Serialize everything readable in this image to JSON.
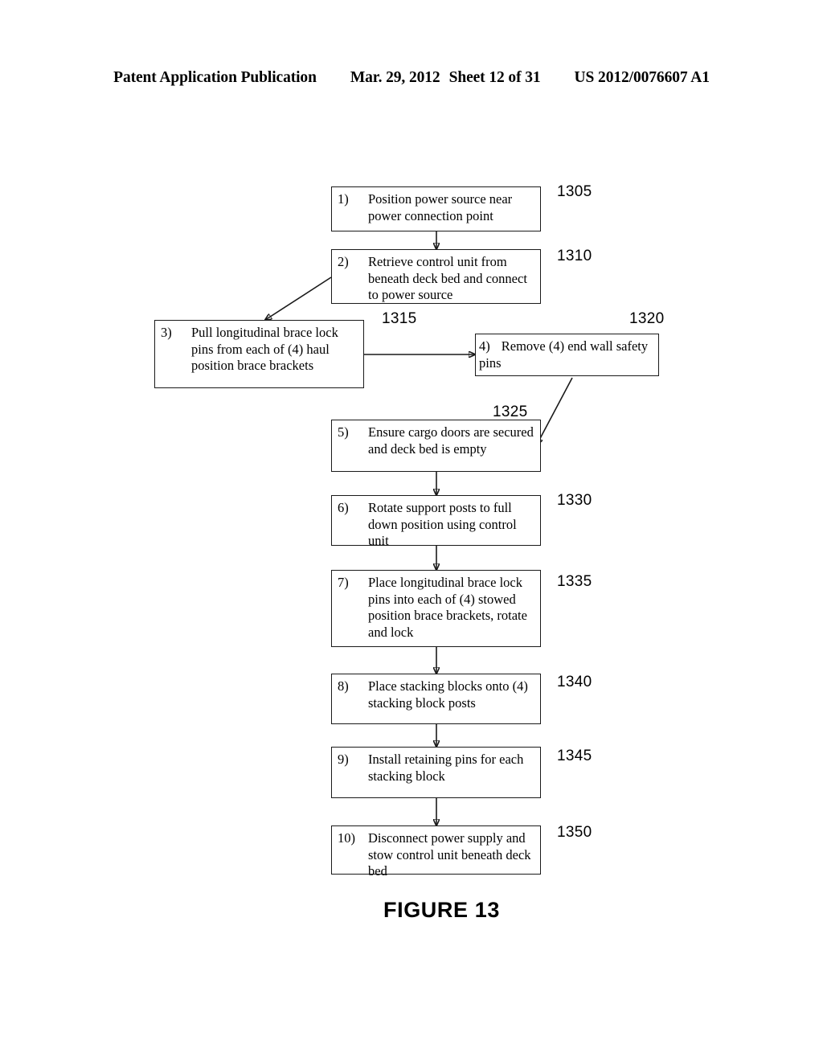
{
  "header": {
    "publication": "Patent Application Publication",
    "date": "Mar. 29, 2012",
    "sheet": "Sheet 12 of 31",
    "patent_number": "US 2012/0076607 A1"
  },
  "figure": {
    "caption": "FIGURE 13"
  },
  "flowchart": {
    "nodes": [
      {
        "id": "step-1",
        "number": "1)",
        "text": "Position power source near power connection point",
        "ref": "1305"
      },
      {
        "id": "step-2",
        "number": "2)",
        "text": "Retrieve control unit from beneath deck bed and connect to power source",
        "ref": "1310"
      },
      {
        "id": "step-3",
        "number": "3)",
        "text": "Pull longitudinal brace lock pins from each of (4) haul position brace brackets",
        "ref": "1315"
      },
      {
        "id": "step-4",
        "number": "4)",
        "text": "Remove (4) end wall safety  pins",
        "ref": "1320"
      },
      {
        "id": "step-5",
        "number": "5)",
        "text": "Ensure cargo doors are secured and deck bed is empty",
        "ref": "1325"
      },
      {
        "id": "step-6",
        "number": "6)",
        "text": "Rotate support posts to full down position using control unit",
        "ref": "1330"
      },
      {
        "id": "step-7",
        "number": "7)",
        "text": "Place longitudinal brace lock pins into each of (4) stowed position brace brackets, rotate and lock",
        "ref": "1335"
      },
      {
        "id": "step-8",
        "number": "8)",
        "text": "Place stacking blocks onto (4) stacking block posts",
        "ref": "1340"
      },
      {
        "id": "step-9",
        "number": "9)",
        "text": "Install retaining pins for each stacking block",
        "ref": "1345"
      },
      {
        "id": "step-10",
        "number": "10)",
        "text": "Disconnect power supply and stow control unit beneath deck bed",
        "ref": "1350"
      }
    ]
  }
}
